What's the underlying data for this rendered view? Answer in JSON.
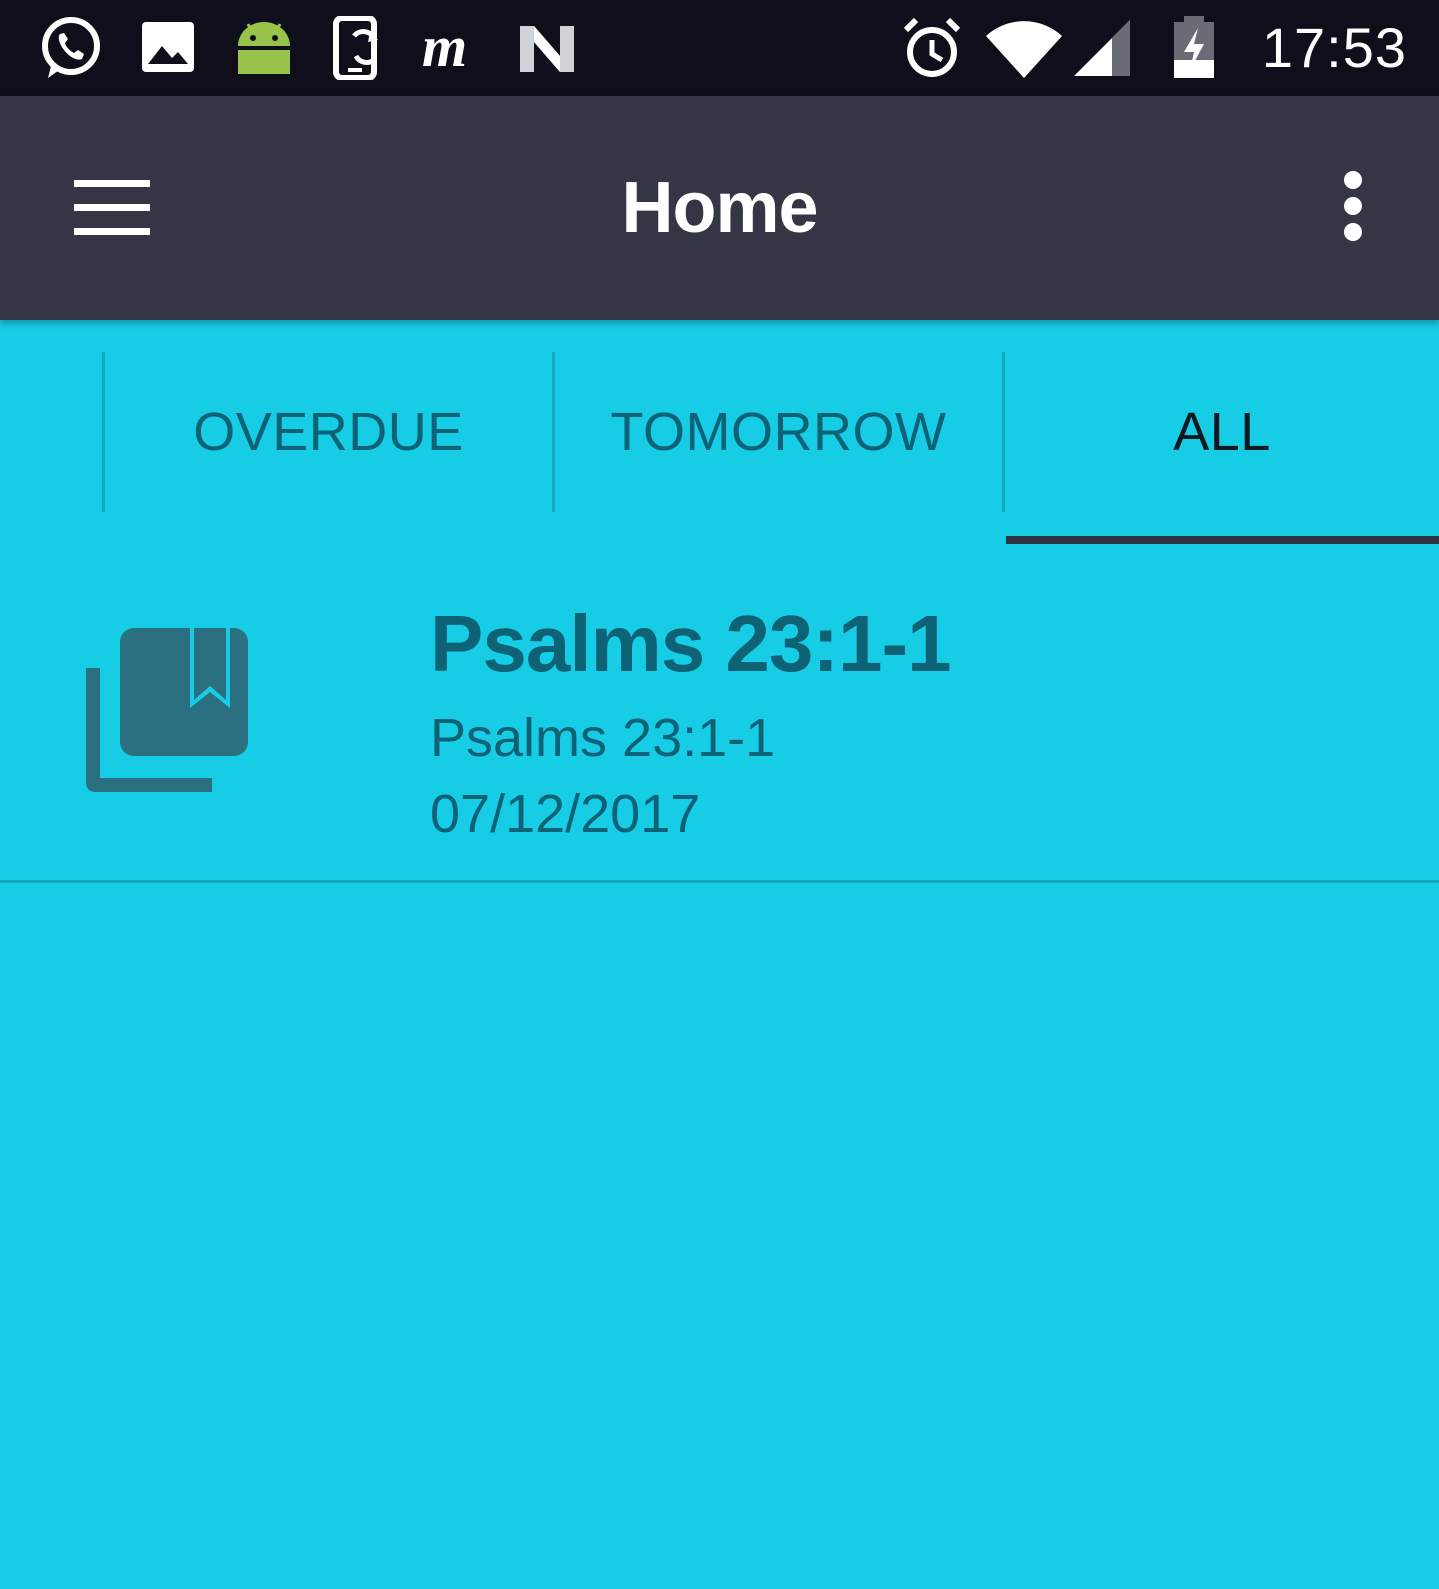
{
  "status_bar": {
    "time": "17:53",
    "notification_icons": [
      "whatsapp-icon",
      "gallery-icon",
      "android-icon",
      "phone-sync-icon",
      "m-app-icon",
      "n-app-icon"
    ],
    "system_icons": [
      "alarm-icon",
      "wifi-icon",
      "cell-signal-icon",
      "battery-charging-icon"
    ]
  },
  "app_bar": {
    "title": "Home",
    "menu_icon": "hamburger-menu-icon",
    "overflow_icon": "more-vert-icon"
  },
  "tabs": {
    "items": [
      {
        "label": "OVERDUE",
        "active": false
      },
      {
        "label": "TOMORROW",
        "active": false
      },
      {
        "label": "ALL",
        "active": true
      }
    ]
  },
  "list": {
    "items": [
      {
        "icon": "library-books-icon",
        "title": "Psalms 23:1-1",
        "subtitle": "Psalms 23:1-1",
        "date": "07/12/2017"
      }
    ]
  },
  "colors": {
    "status_bar_bg": "#0e0f1b",
    "app_bar_bg": "#353645",
    "content_bg": "#17cde6",
    "text_dark_teal": "#0e6276",
    "tab_active_text": "#0b1820",
    "tab_indicator": "#2d3340",
    "icon_color": "#2b7080"
  }
}
